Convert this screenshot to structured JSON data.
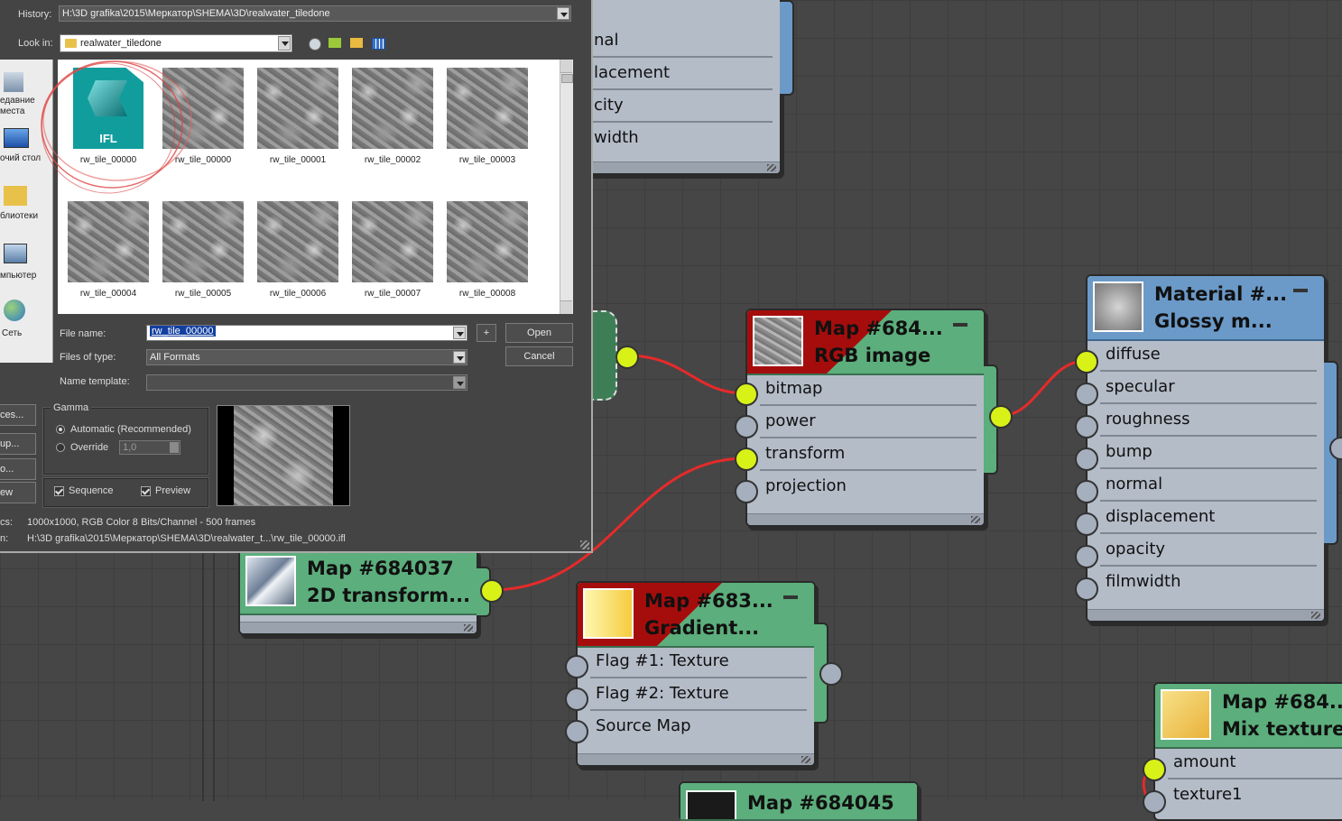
{
  "dialog": {
    "history_label": "History:",
    "history_value": "H:\\3D grafika\\2015\\Меркатор\\SHEMA\\3D\\realwater_tiledone",
    "lookin_label": "Look in:",
    "lookin_value": "realwater_tiledone",
    "sidebar": [
      "едавние\nместа",
      "очий стол",
      "блиотеки",
      "мпьютер",
      "Сеть"
    ],
    "files": [
      {
        "name": "rw_tile_00000",
        "type": "IFL",
        "icon_text": "IFL"
      },
      {
        "name": "rw_tile_00000",
        "type": "texture"
      },
      {
        "name": "rw_tile_00001",
        "type": "texture"
      },
      {
        "name": "rw_tile_00002",
        "type": "texture"
      },
      {
        "name": "rw_tile_00003",
        "type": "texture"
      },
      {
        "name": "rw_tile_00004",
        "type": "texture"
      },
      {
        "name": "rw_tile_00005",
        "type": "texture"
      },
      {
        "name": "rw_tile_00006",
        "type": "texture"
      },
      {
        "name": "rw_tile_00007",
        "type": "texture"
      },
      {
        "name": "rw_tile_00008",
        "type": "texture"
      }
    ],
    "filename_label": "File name:",
    "filename_value": "rw_tile_00000",
    "filetype_label": "Files of type:",
    "filetype_value": "All Formats",
    "nametemplate_label": "Name template:",
    "nametemplate_value": "",
    "plus_label": "+",
    "open_label": "Open",
    "cancel_label": "Cancel",
    "left_buttons": [
      "ces...",
      "up...",
      "o...",
      "ew"
    ],
    "gamma_label": "Gamma",
    "gamma_auto": "Automatic (Recommended)",
    "gamma_override": "Override",
    "gamma_value": "1,0",
    "sequence_label": "Sequence",
    "preview_label": "Preview",
    "stats_label": "cs:",
    "stats_value": "1000x1000, RGB Color 8 Bits/Channel - 500 frames",
    "location_label": "n:",
    "location_value": "H:\\3D grafika\\2015\\Меркатор\\SHEMA\\3D\\realwater_t...\\rw_tile_00000.ifl"
  },
  "nodes": {
    "top": {
      "items": [
        "nal",
        "lacement",
        "city",
        "width"
      ]
    },
    "bitmap_node": {
      "title": "Map #684...",
      "subtitle": "RGB image",
      "ports": [
        "bitmap",
        "power",
        "transform",
        "projection"
      ]
    },
    "material_node": {
      "title": "Material #...",
      "subtitle": "Glossy m...",
      "ports": [
        "diffuse",
        "specular",
        "roughness",
        "bump",
        "normal",
        "displacement",
        "opacity",
        "filmwidth"
      ]
    },
    "transform_node": {
      "title": "Map #684037",
      "subtitle": "2D transform..."
    },
    "gradient_node": {
      "title": "Map #683...",
      "subtitle": "Gradient...",
      "ports": [
        "Flag #1: Texture",
        "Flag #2: Texture",
        "Source Map"
      ]
    },
    "mix_node": {
      "title": "Map #684...",
      "subtitle": "Mix texture",
      "ports": [
        "amount",
        "texture1"
      ]
    },
    "bottom_node": {
      "title": "Map #684045"
    }
  },
  "colors": {
    "node_green": "#5cae7c",
    "node_blue": "#6b9ac8",
    "node_body": "#b4bcc8",
    "wire": "#e62a2a",
    "port_active": "#d8f218",
    "header_red": "#a50d0d"
  }
}
